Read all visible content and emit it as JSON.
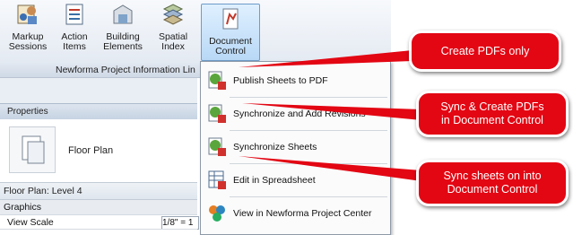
{
  "ribbon": {
    "buttons": [
      {
        "label_line1": "Markup",
        "label_line2": "Sessions",
        "icon": "markup-sessions-icon"
      },
      {
        "label_line1": "Action",
        "label_line2": "Items",
        "icon": "action-items-icon"
      },
      {
        "label_line1": "Building",
        "label_line2": "Elements",
        "icon": "building-elements-icon"
      },
      {
        "label_line1": "Spatial",
        "label_line2": "Index",
        "icon": "spatial-index-icon"
      },
      {
        "label_line1": "Document",
        "label_line2": "Control",
        "icon": "document-control-icon"
      }
    ],
    "panel_title": "Newforma Project Information Lin"
  },
  "properties": {
    "header": "Properties",
    "type_name": "Floor Plan",
    "level": "Floor Plan: Level 4",
    "group": "Graphics",
    "view_scale_label": "View Scale",
    "view_scale_value": "1/8\" = 1"
  },
  "menu": {
    "items": [
      {
        "label": "Publish Sheets to PDF",
        "icon": "publish-pdf-icon"
      },
      {
        "label": "Synchronize and Add Revisions",
        "icon": "sync-revisions-icon"
      },
      {
        "label": "Synchronize Sheets",
        "icon": "sync-sheets-icon"
      },
      {
        "label": "Edit in Spreadsheet",
        "icon": "spreadsheet-icon"
      },
      {
        "label": "View in Newforma Project Center",
        "icon": "project-center-icon"
      }
    ]
  },
  "callouts": [
    {
      "line1": "Create PDFs only",
      "line2": ""
    },
    {
      "line1": "Sync & Create PDFs",
      "line2": "in Document Control"
    },
    {
      "line1": "Sync sheets on into",
      "line2": "Document Control"
    }
  ],
  "colors": {
    "callout": "#e30613",
    "ribbon_active": "#b8d8f6"
  }
}
